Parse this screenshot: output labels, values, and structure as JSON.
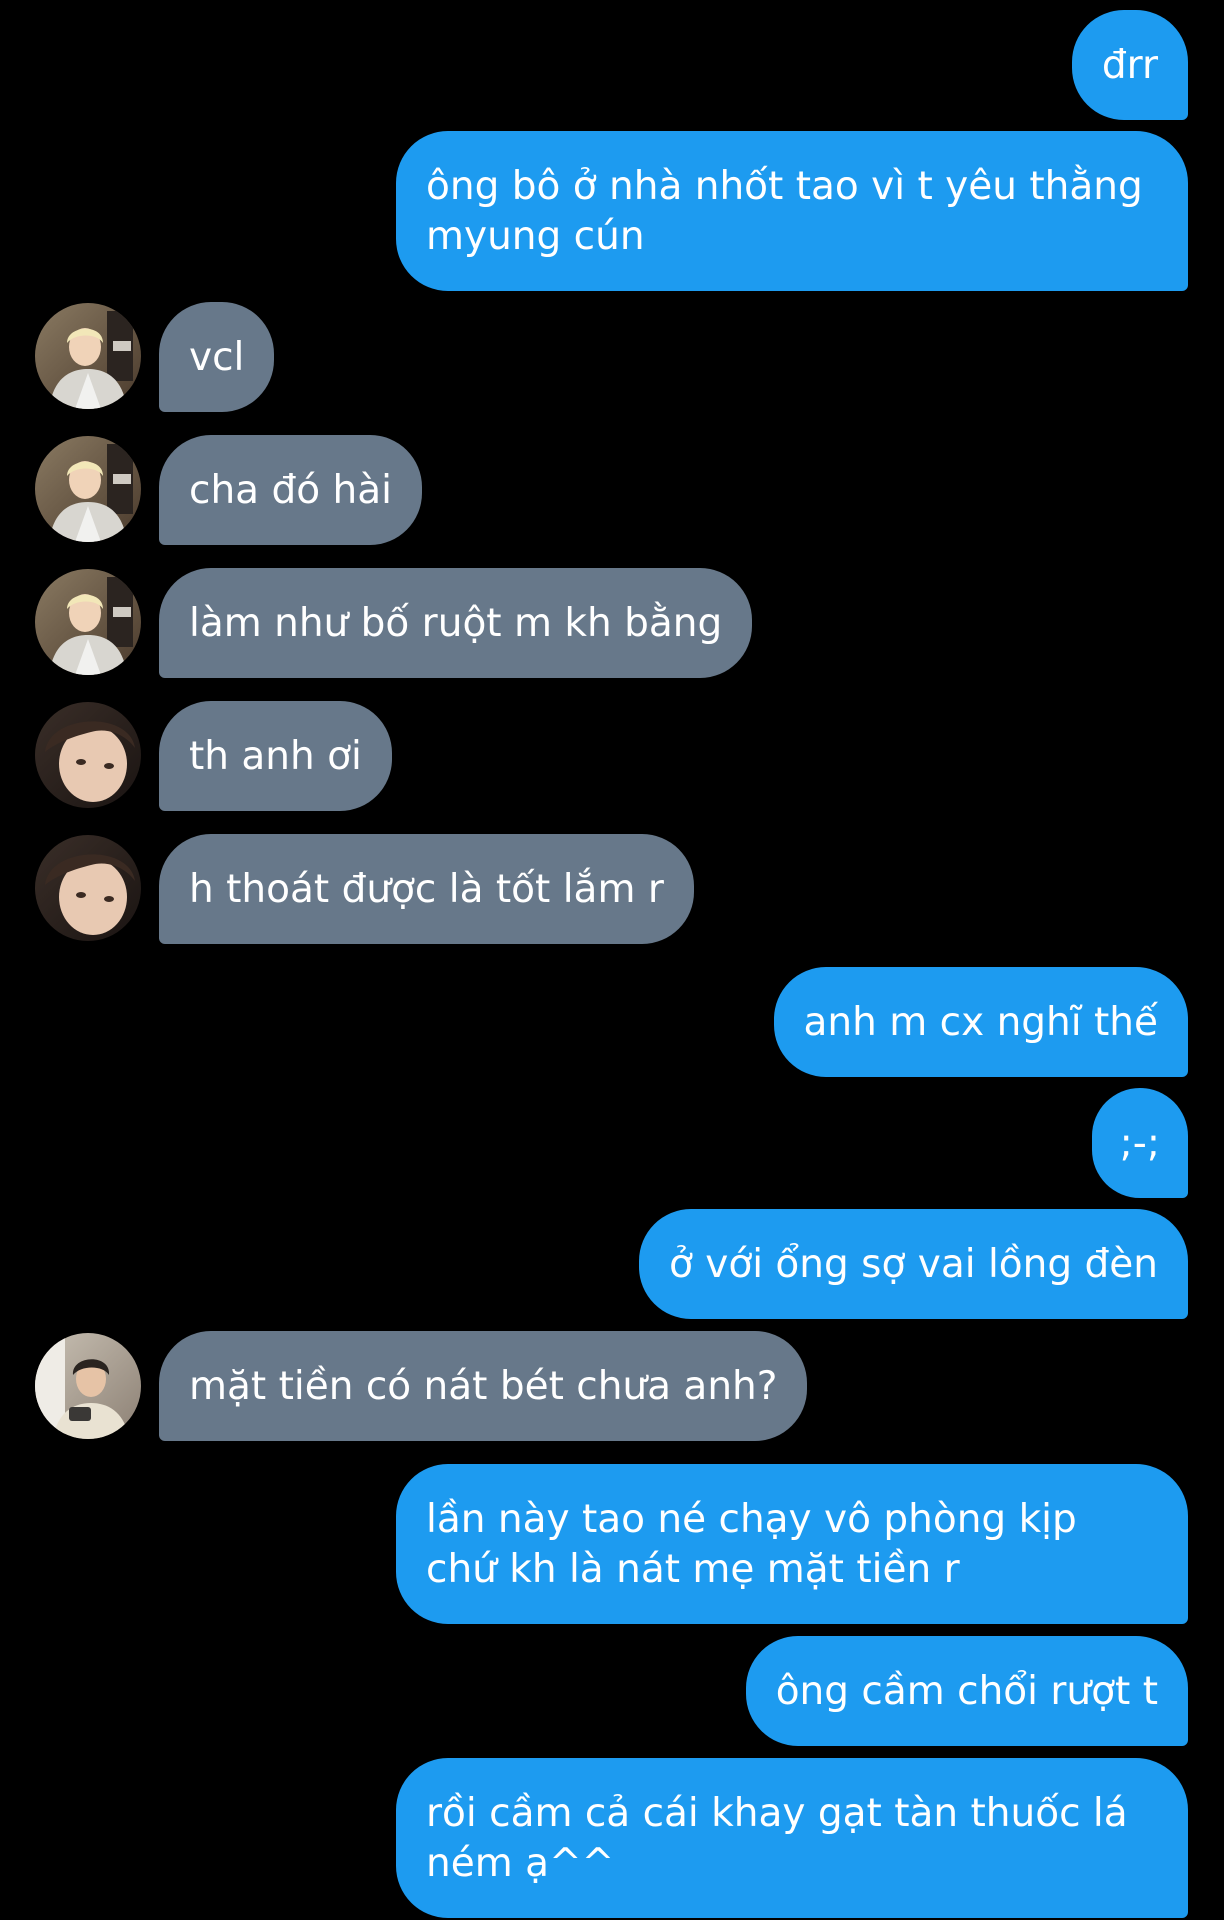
{
  "messages": [
    {
      "text": "đrr",
      "from": "me"
    },
    {
      "text": "ông bô ở nhà nhốt tao vì t yêu thằng myung cún",
      "from": "me"
    },
    {
      "text": "vcl",
      "from": "friend-a"
    },
    {
      "text": "cha đó hài",
      "from": "friend-a"
    },
    {
      "text": "làm như bố ruột m kh bằng",
      "from": "friend-a"
    },
    {
      "text": "th anh ơi",
      "from": "friend-b"
    },
    {
      "text": "h thoát được là tốt lắm r",
      "from": "friend-b"
    },
    {
      "text": "anh m cx nghĩ thế",
      "from": "me"
    },
    {
      "text": ";-;",
      "from": "me"
    },
    {
      "text": "ở với ổng sợ vai lồng đèn",
      "from": "me"
    },
    {
      "text": "mặt tiền có nát bét chưa anh?",
      "from": "friend-c"
    },
    {
      "text": "lần này tao né chạy vô phòng kịp chứ kh là nát mẹ mặt tiền r",
      "from": "me"
    },
    {
      "text": "ông cầm chổi rượt t",
      "from": "me"
    },
    {
      "text": "rồi cầm cả cái khay gạt tàn thuốc lá ném ạ^^",
      "from": "me"
    }
  ],
  "colors": {
    "background": "#000000",
    "outgoing_bubble": "#1d9bf0",
    "incoming_bubble": "#67788a",
    "text": "#ffffff"
  }
}
